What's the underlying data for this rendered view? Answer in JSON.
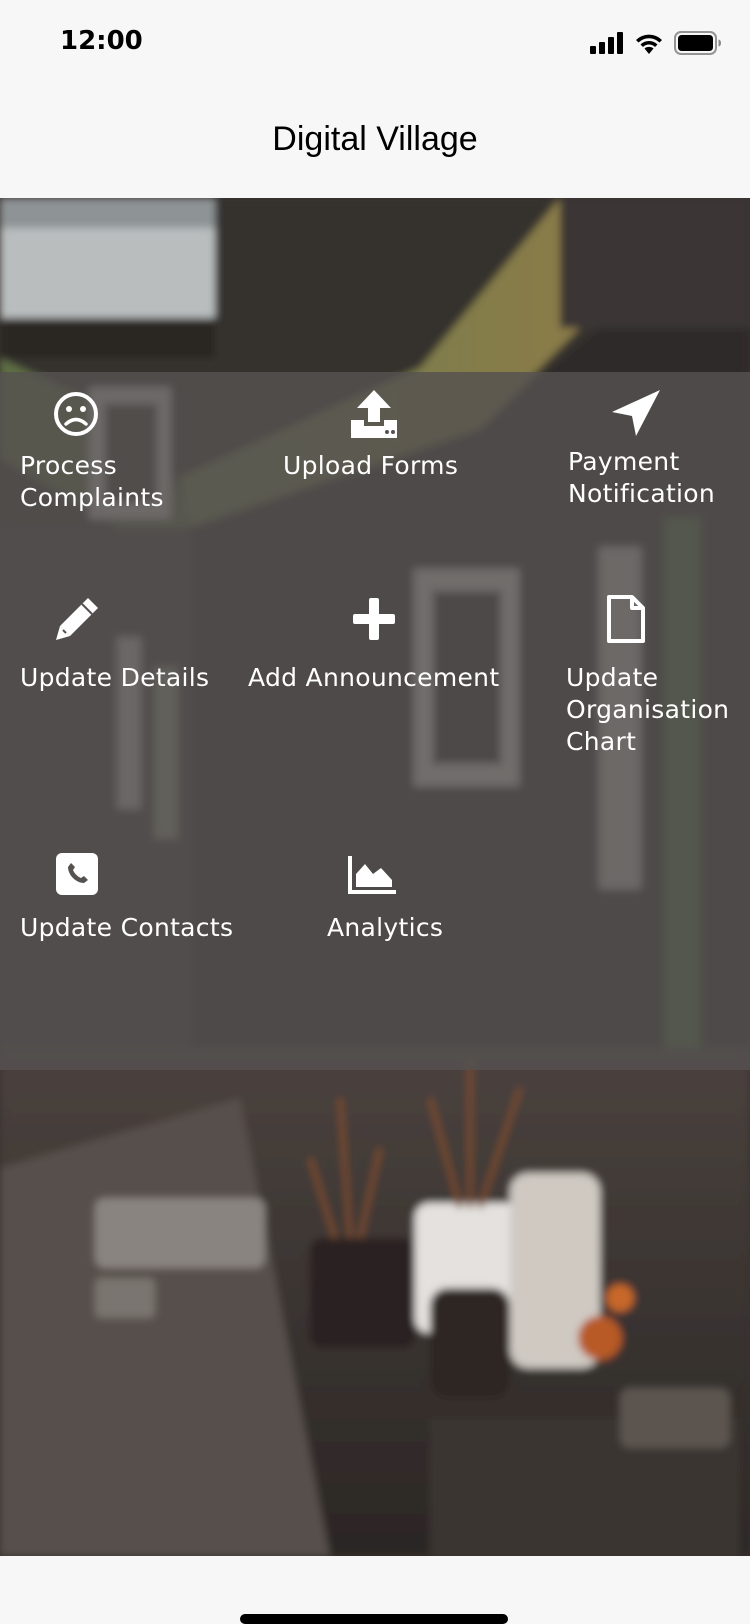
{
  "status_bar": {
    "time": "12:00",
    "icons": [
      "signal-icon",
      "wifi-icon",
      "battery-icon"
    ]
  },
  "nav": {
    "title": "Digital Village"
  },
  "menu": {
    "items": [
      {
        "label": "Process\nComplaints",
        "icon": "sad-face-icon"
      },
      {
        "label": "Upload Forms",
        "icon": "upload-icon"
      },
      {
        "label": "Payment\nNotification",
        "icon": "location-arrow-icon"
      },
      {
        "label": "Update Details",
        "icon": "pencil-icon"
      },
      {
        "label": "Add Announcement",
        "icon": "plus-icon"
      },
      {
        "label": "Update\nOrganisation\nChart",
        "icon": "document-icon"
      },
      {
        "label": "Update Contacts",
        "icon": "phone-square-icon"
      },
      {
        "label": "Analytics",
        "icon": "area-chart-icon"
      }
    ]
  },
  "colors": {
    "overlay": "#555250",
    "bar_background": "#f7f7f7",
    "icon": "#ffffff"
  }
}
